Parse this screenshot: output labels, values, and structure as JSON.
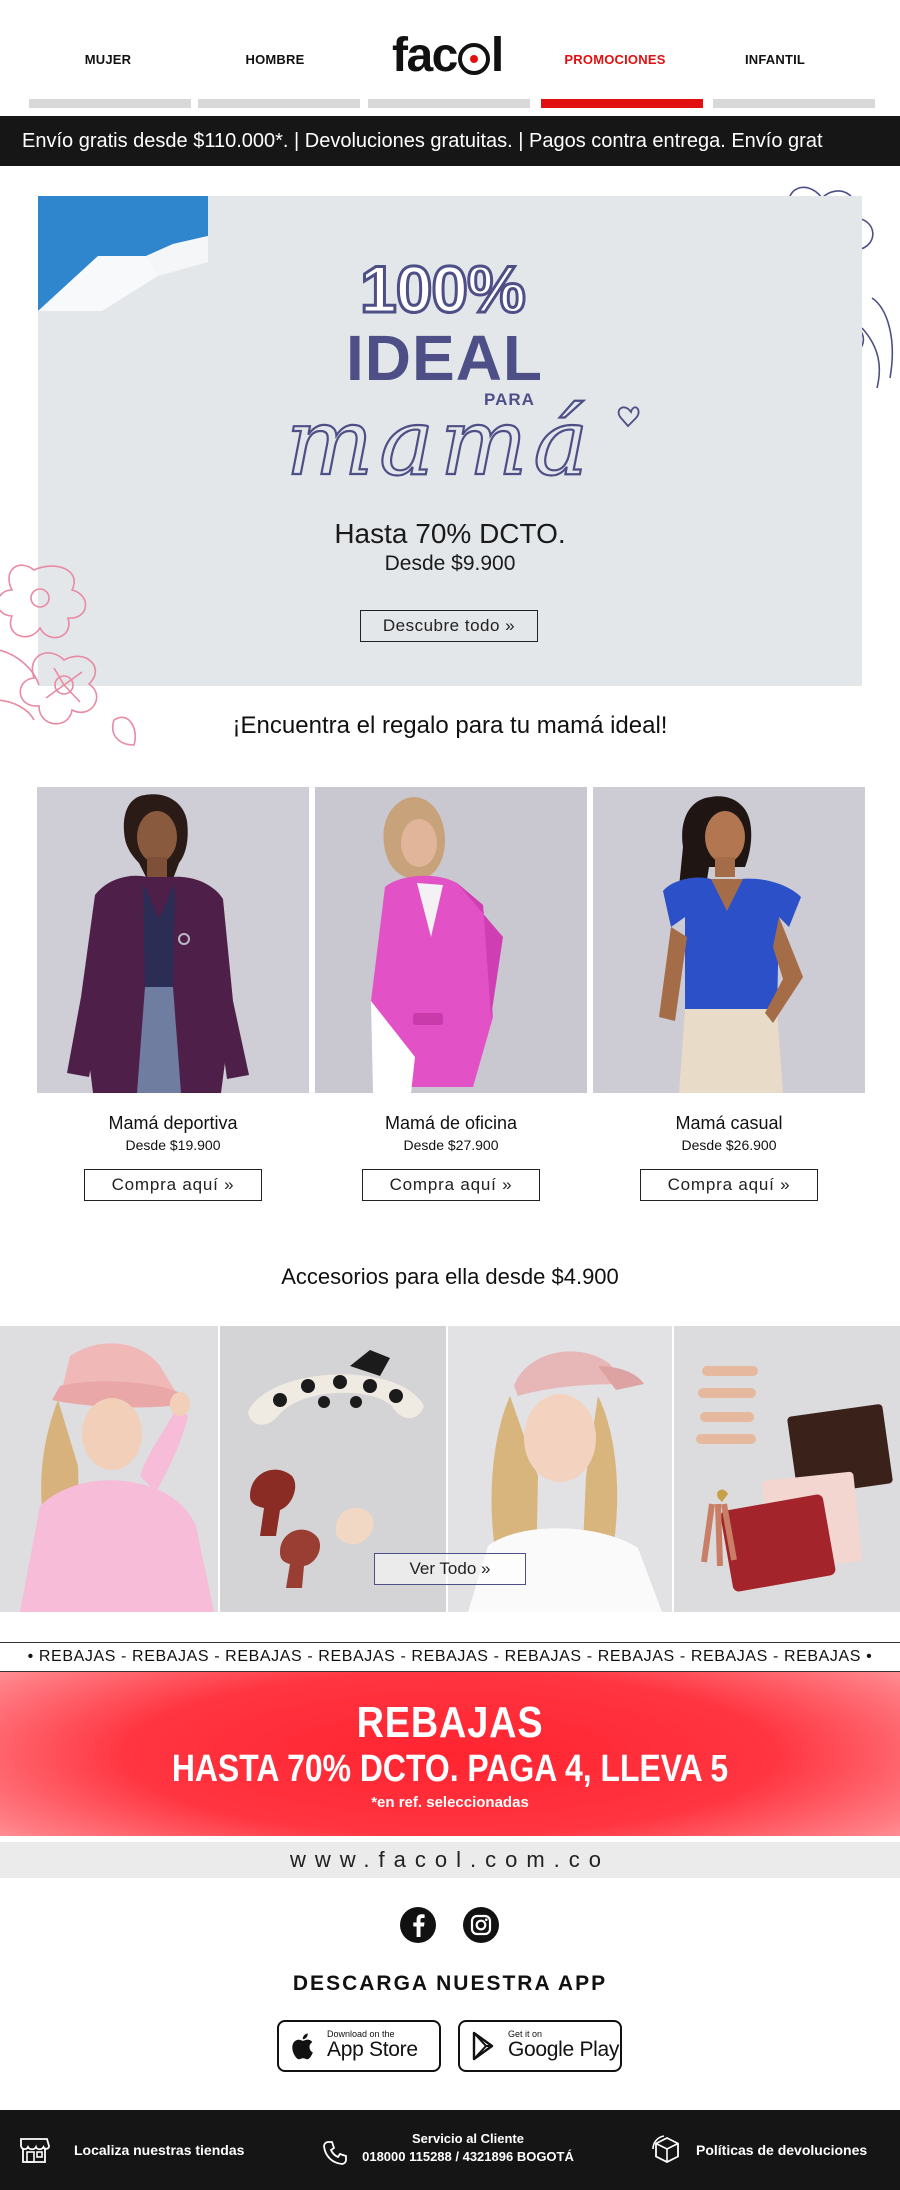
{
  "nav": {
    "items": [
      {
        "label": "MUJER",
        "active": false
      },
      {
        "label": "HOMBRE",
        "active": false
      },
      {
        "label": "PROMOCIONES",
        "active": true
      },
      {
        "label": "INFANTIL",
        "active": false
      }
    ],
    "logo": {
      "part1": "fac",
      "part2": "l"
    }
  },
  "ticker": {
    "text": "Envío gratis desde $110.000*.  |  Devoluciones gratuitas.  |  Pagos contra entrega.  Envío grat"
  },
  "hero": {
    "line1": "100%",
    "line2": "IDEAL",
    "line3": "PARA",
    "line4": "mamá",
    "discount": "Hasta 70% DCTO.",
    "from": "Desde $9.900",
    "button": "Descubre todo »"
  },
  "gift_title": "¡Encuentra el regalo para tu mamá ideal!",
  "cards": [
    {
      "name": "Mamá deportiva",
      "price": "Desde $19.900",
      "button": "Compra aquí »"
    },
    {
      "name": "Mamá de oficina",
      "price": "Desde $27.900",
      "button": "Compra aquí »"
    },
    {
      "name": "Mamá casual",
      "price": "Desde $26.900",
      "button": "Compra aquí »"
    }
  ],
  "accessories": {
    "title": "Accesorios para ella desde $4.900",
    "button": "Ver Todo »"
  },
  "rebajas": {
    "line": "•  REBAJAS - REBAJAS - REBAJAS - REBAJAS - REBAJAS - REBAJAS - REBAJAS - REBAJAS - REBAJAS  •",
    "title": "REBAJAS",
    "subtitle": "HASTA 70% DCTO. PAGA 4, LLEVA 5",
    "note": "*en ref. seleccionadas"
  },
  "site_url": "www.facol.com.co",
  "app": {
    "title": "DESCARGA NUESTRA APP",
    "appstore_small": "Download on the",
    "appstore_big": "App Store",
    "googleplay_small": "Get it on",
    "googleplay_big": "Google Play"
  },
  "footer": {
    "stores": "Localiza nuestras tiendas",
    "service_title": "Servicio al Cliente",
    "service_phone": "018000 115288 / 4321896 BOGOTÁ",
    "returns": "Políticas de devoluciones"
  },
  "colors": {
    "accent_red": "#e10f0f",
    "hero_purple": "#4d4f86",
    "ribbon_blue": "#2f86cc",
    "footer_bg": "#151515"
  }
}
